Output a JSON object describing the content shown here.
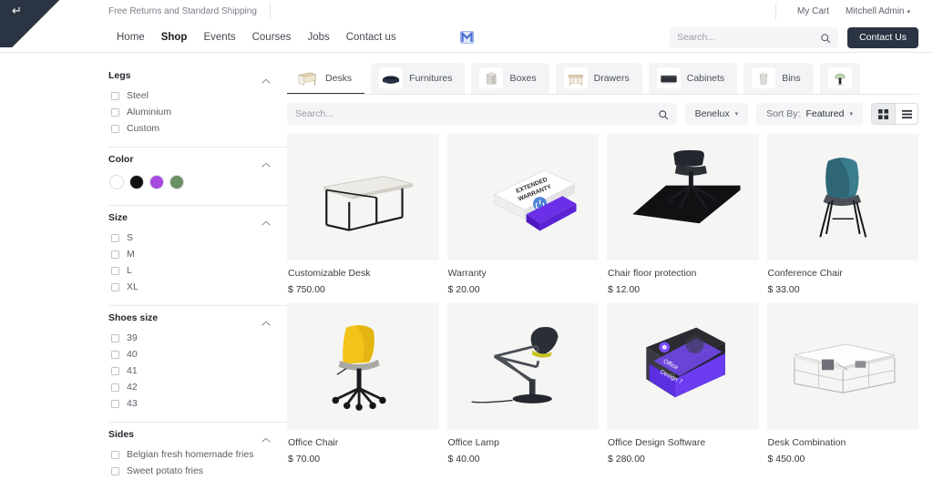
{
  "topbar": {
    "promo": "Free Returns and Standard Shipping",
    "cart": "My Cart",
    "user": "Mitchell Admin",
    "user_caret": "▾"
  },
  "nav": {
    "links": [
      {
        "label": "Home",
        "active": false
      },
      {
        "label": "Shop",
        "active": true
      },
      {
        "label": "Events",
        "active": false
      },
      {
        "label": "Courses",
        "active": false
      },
      {
        "label": "Jobs",
        "active": false
      },
      {
        "label": "Contact us",
        "active": false
      }
    ],
    "search_placeholder": "Search...",
    "search_value": "",
    "contact_button": "Contact Us",
    "logo_icon": "brand-m-logo-icon",
    "search_icon": "search-icon"
  },
  "sidebar": {
    "groups": [
      {
        "title": "Legs",
        "type": "checkbox",
        "options": [
          "Steel",
          "Aluminium",
          "Custom"
        ]
      },
      {
        "title": "Color",
        "type": "swatch",
        "swatches": [
          "#ffffff",
          "#111111",
          "#a64ae0",
          "#6b9065"
        ]
      },
      {
        "title": "Size",
        "type": "checkbox",
        "options": [
          "S",
          "M",
          "L",
          "XL"
        ]
      },
      {
        "title": "Shoes size",
        "type": "checkbox",
        "options": [
          "39",
          "40",
          "41",
          "42",
          "43"
        ]
      },
      {
        "title": "Sides",
        "type": "checkbox",
        "options": [
          "Belgian fresh homemade fries",
          "Sweet potato fries"
        ]
      }
    ],
    "collapse_icon": "chevron-up-icon"
  },
  "categories": [
    {
      "label": "Desks",
      "icon": "desk-icon",
      "active": true
    },
    {
      "label": "Furnitures",
      "icon": "sofa-icon",
      "active": false
    },
    {
      "label": "Boxes",
      "icon": "box-icon",
      "active": false
    },
    {
      "label": "Drawers",
      "icon": "drawer-icon",
      "active": false
    },
    {
      "label": "Cabinets",
      "icon": "cabinet-icon",
      "active": false
    },
    {
      "label": "Bins",
      "icon": "bin-icon",
      "active": false
    },
    {
      "label": "",
      "icon": "lamp-icon",
      "active": false
    }
  ],
  "toolbar": {
    "search_placeholder": "Search...",
    "search_value": "",
    "search_icon": "search-icon",
    "region_label": "Benelux",
    "sort_prefix": "Sort By:",
    "sort_value": "Featured",
    "caret": "▾",
    "grid_view_icon": "grid-view-icon",
    "list_view_icon": "list-view-icon",
    "active_view": "grid"
  },
  "products": [
    {
      "name": "Customizable Desk",
      "price": "$ 750.00",
      "image": "desk"
    },
    {
      "name": "Warranty",
      "price": "$ 20.00",
      "image": "warranty"
    },
    {
      "name": "Chair floor protection",
      "price": "$ 12.00",
      "image": "floormat"
    },
    {
      "name": "Conference Chair",
      "price": "$ 33.00",
      "image": "conferencechair"
    },
    {
      "name": "Office Chair",
      "price": "$ 70.00",
      "image": "officechair"
    },
    {
      "name": "Office Lamp",
      "price": "$ 40.00",
      "image": "lamp"
    },
    {
      "name": "Office Design Software",
      "price": "$ 280.00",
      "image": "software"
    },
    {
      "name": "Desk Combination",
      "price": "$ 450.00",
      "image": "deskcombo"
    }
  ],
  "colors": {
    "accent": "#2b3443",
    "panel": "#f4f5f6",
    "product_bg": "#f5f5f5"
  }
}
